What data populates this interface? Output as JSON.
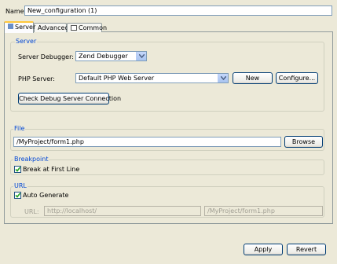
{
  "name": {
    "label": "Name:",
    "value": "New_configuration (1)"
  },
  "tabs": [
    {
      "label": "Server"
    },
    {
      "label": "Advanced"
    },
    {
      "label": "Common"
    }
  ],
  "server_group": {
    "title": "Server",
    "debugger_label": "Server Debugger:",
    "debugger_value": "Zend Debugger",
    "php_server_label": "PHP Server:",
    "php_server_value": "Default PHP Web Server",
    "new_button": "New",
    "configure_button": "Configure...",
    "check_button": "Check Debug Server Connection"
  },
  "file_group": {
    "title": "File",
    "value": "/MyProject/form1.php",
    "browse_button": "Browse"
  },
  "breakpoint_group": {
    "title": "Breakpoint",
    "break_first_line": "Break at First Line",
    "break_first_line_checked": true
  },
  "url_group": {
    "title": "URL",
    "auto_generate": "Auto Generate",
    "auto_generate_checked": true,
    "url_label": "URL:",
    "url_base": "http://localhost/",
    "url_path": "/MyProject/form1.php"
  },
  "footer": {
    "apply": "Apply",
    "revert": "Revert"
  }
}
